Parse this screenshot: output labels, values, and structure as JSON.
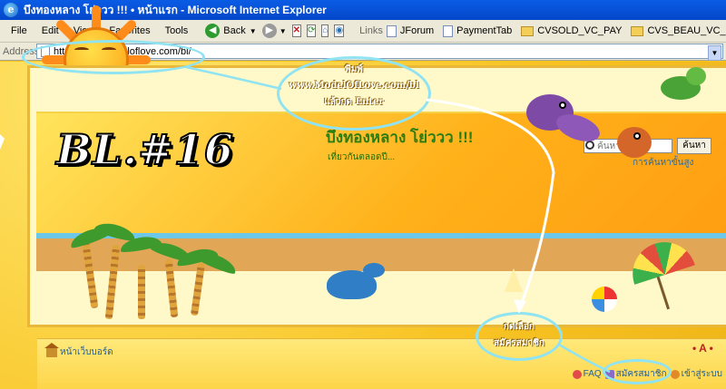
{
  "window": {
    "title": "บึงทองหลาง โย่ววว !!! • หน้าแรก - Microsoft Internet Explorer"
  },
  "menu": [
    "File",
    "Edit",
    "View",
    "Favorites",
    "Tools"
  ],
  "toolbar": {
    "back_label": "Back",
    "links_label": "Links",
    "links": [
      "JForum",
      "PaymentTab",
      "CVSOLD_VC_PAY",
      "CVS_BEAU_VC_PAY_"
    ]
  },
  "address": {
    "label": "Address",
    "url": "http://www.modeloflove.com/bl/"
  },
  "banner": {
    "logo_text": "BL.#16",
    "site_title": "บึงทองหลาง โย่ววว !!!",
    "site_description": "เที่ยวกันตลอดปี...",
    "search_placeholder": "ค้นหา...",
    "search_button": "ค้นหา",
    "advanced_search": "การค้นหาขั้นสูง"
  },
  "nav": {
    "forum_home": "หน้าเว็บบอร์ด",
    "font_size_control": "• A •",
    "faq": "FAQ",
    "register": "สมัครสมาชิก",
    "login": "เข้าสู่ระบบ"
  },
  "annotations": {
    "url_instruction": [
      "พิมพ์",
      "www.ModelOfLove.com/bl",
      "แล้วกด Enter"
    ],
    "register_instruction": [
      "กดเลือก",
      "สมัครสมาชิก"
    ],
    "color": "#8fe3f2"
  }
}
